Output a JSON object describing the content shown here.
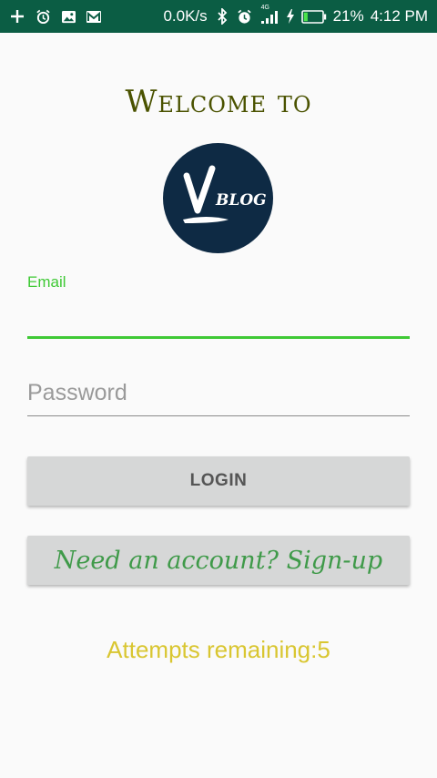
{
  "status_bar": {
    "network_speed": "0.0K/s",
    "network_type": "4G",
    "battery_percent": "21%",
    "time": "4:12 PM",
    "icons": [
      "plus-icon",
      "alarm-icon",
      "image-icon",
      "gmail-icon",
      "bluetooth-icon",
      "alarm-clock-icon",
      "signal-icon",
      "charging-icon",
      "battery-icon"
    ],
    "battery_level": 0.21,
    "background_color": "#0b5d44"
  },
  "login": {
    "welcome_title": "Welcome to",
    "logo_text": {
      "letter": "V",
      "word": "BLOG"
    },
    "email_label": "Email",
    "email_value": "",
    "password_placeholder": "Password",
    "password_value": "",
    "login_button": "LOGIN",
    "signup_button": "Need an account? Sign-up",
    "attempts_text": "Attempts remaining:5"
  },
  "colors": {
    "accent_green": "#3fc935",
    "title_olive": "#4a5200",
    "signup_text": "#3f9a49",
    "attempts_text": "#d9c631",
    "logo_background": "#0e2a44"
  }
}
